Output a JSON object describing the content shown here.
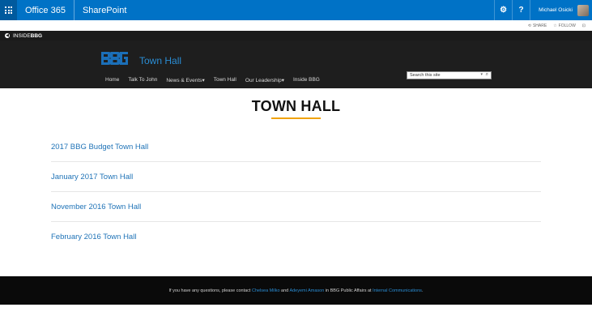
{
  "suite": {
    "brand": "Office 365",
    "app": "SharePoint",
    "user_name": "Michael Osicki"
  },
  "actions": {
    "share": "SHARE",
    "follow": "FOLLOW"
  },
  "topstrip": {
    "label": "INSIDE"
  },
  "site": {
    "logo_text": "BBG",
    "title": "Town Hall",
    "search_placeholder": "Search this site",
    "nav": [
      {
        "label": "Home"
      },
      {
        "label": "Talk To John"
      },
      {
        "label": "News & Events"
      },
      {
        "label": "Town Hall"
      },
      {
        "label": "Our Leadership"
      },
      {
        "label": "Inside BBG"
      }
    ]
  },
  "main": {
    "heading": "TOWN HALL",
    "items": [
      {
        "label": "2017 BBG Budget Town Hall"
      },
      {
        "label": "January 2017 Town Hall"
      },
      {
        "label": "November 2016 Town Hall"
      },
      {
        "label": "February 2016 Town Hall"
      }
    ]
  },
  "footer": {
    "text_1": "If you have any questions, please contact ",
    "contact_1": "Chelsea Milko",
    "text_2": " and ",
    "contact_2": "Adeyemi Amason",
    "text_3": " in BBG Public Affairs at ",
    "link": "Internal Communications",
    "text_4": "."
  },
  "colors": {
    "suite_blue": "#0072c6",
    "link_blue": "#1f73b7",
    "accent_gold": "#f0a30a",
    "header_dark": "#1e1e1e"
  }
}
